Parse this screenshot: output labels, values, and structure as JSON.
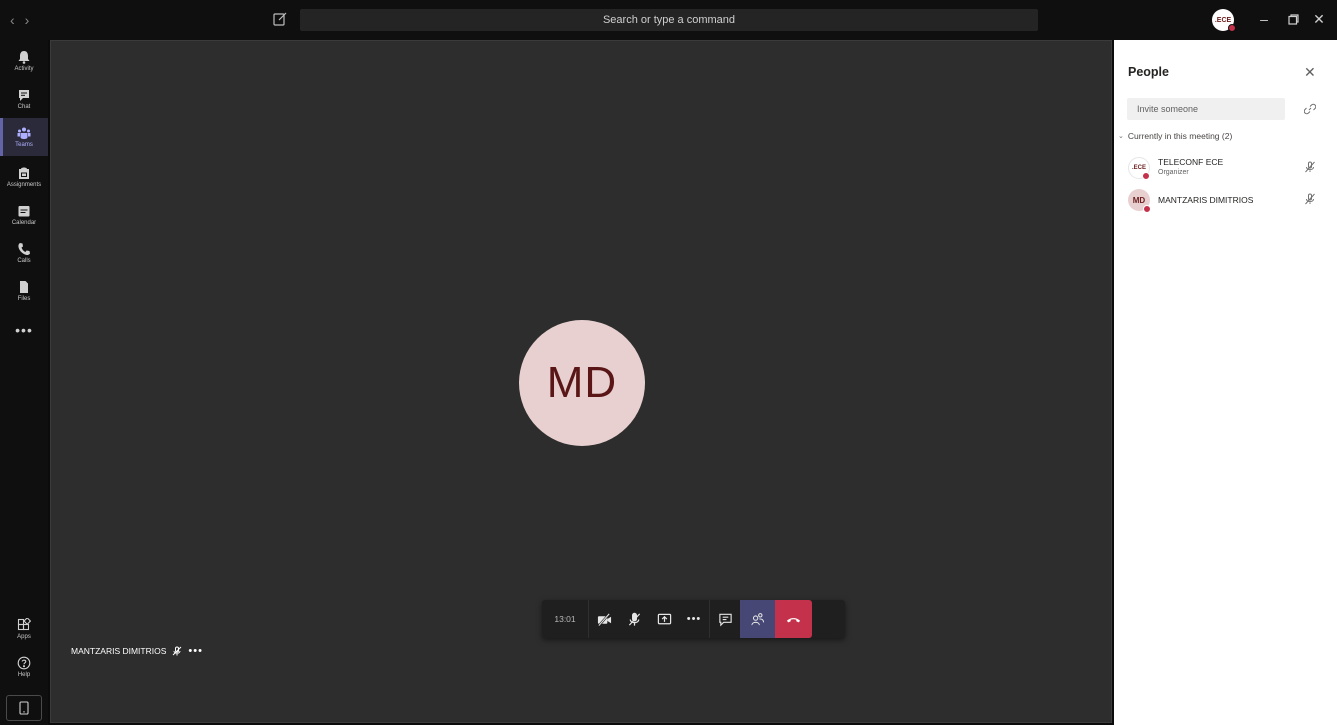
{
  "titlebar": {
    "search_placeholder": "Search or type a command",
    "account_initials": ".ECE"
  },
  "rail": {
    "items": [
      {
        "label": "Activity",
        "icon": "bell-icon"
      },
      {
        "label": "Chat",
        "icon": "chat-icon"
      },
      {
        "label": "Teams",
        "icon": "teams-icon",
        "active": true
      },
      {
        "label": "Assignments",
        "icon": "assignments-icon"
      },
      {
        "label": "Calendar",
        "icon": "calendar-icon"
      },
      {
        "label": "Calls",
        "icon": "phone-icon"
      },
      {
        "label": "Files",
        "icon": "file-icon"
      }
    ],
    "more_label": "•••",
    "bottom_items": [
      {
        "label": "Apps",
        "icon": "apps-icon"
      },
      {
        "label": "Help",
        "icon": "help-icon"
      }
    ]
  },
  "stage": {
    "avatar_initials": "MD",
    "self_name": "MANTZARIS DIMITRIOS",
    "self_more": "•••"
  },
  "callbar": {
    "timer": "13:01",
    "more_label": "•••"
  },
  "people_panel": {
    "title": "People",
    "invite_placeholder": "Invite someone",
    "section_label": "Currently in this meeting (2)",
    "participants": [
      {
        "initials": ".ECE",
        "name": "TELECONF ECE",
        "role": "Organizer"
      },
      {
        "initials": "MD",
        "name": "MANTZARIS DIMITRIOS",
        "role": ""
      }
    ]
  },
  "colors": {
    "accent": "#6264a7",
    "hangup": "#c4314b",
    "stage_bg": "#2d2d2d",
    "avatar_bg": "#e8d0d0"
  }
}
